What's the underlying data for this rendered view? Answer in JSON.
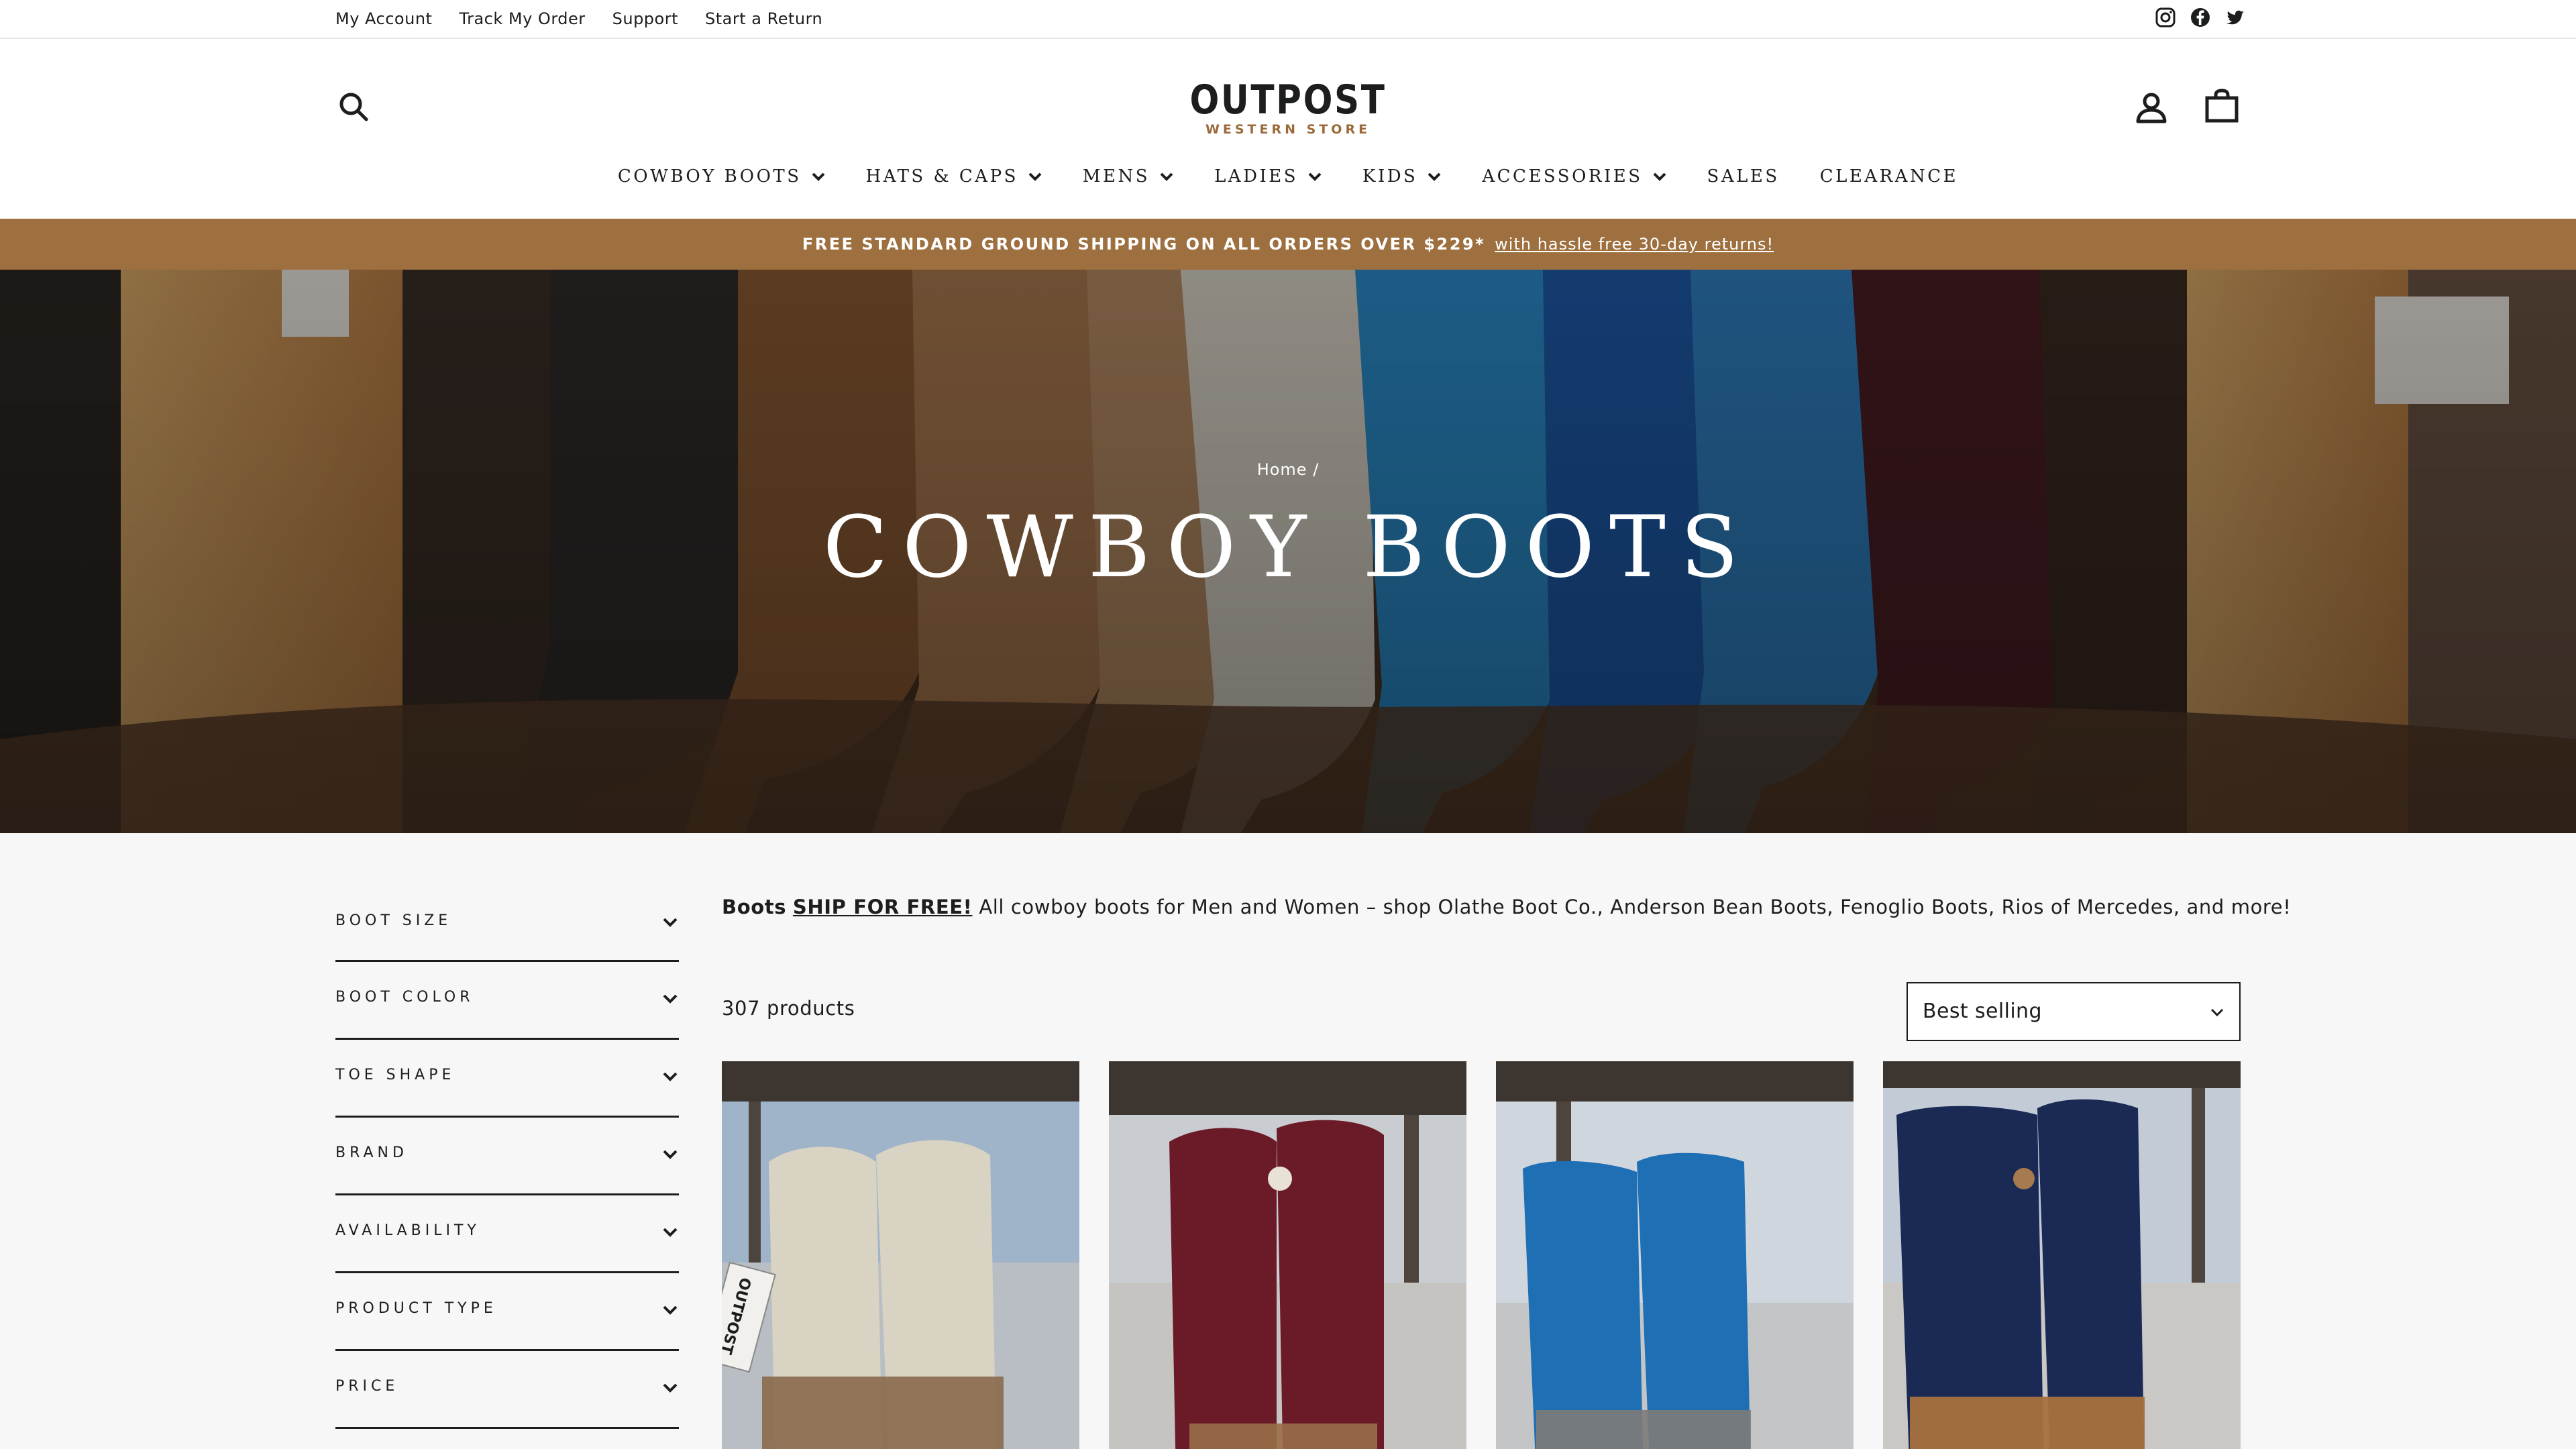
{
  "utility": {
    "links": [
      "My Account",
      "Track My Order",
      "Support",
      "Start a Return"
    ],
    "social": [
      "instagram-icon",
      "facebook-icon",
      "twitter-icon"
    ]
  },
  "header": {
    "logo_main": "OUTPOST",
    "logo_sub": "WESTERN STORE",
    "icons": [
      "search-icon",
      "account-icon",
      "cart-icon"
    ]
  },
  "nav": {
    "items": [
      {
        "label": "COWBOY BOOTS",
        "dropdown": true
      },
      {
        "label": "HATS & CAPS",
        "dropdown": true
      },
      {
        "label": "MENS",
        "dropdown": true
      },
      {
        "label": "LADIES",
        "dropdown": true
      },
      {
        "label": "KIDS",
        "dropdown": true
      },
      {
        "label": "ACCESSORIES",
        "dropdown": true
      },
      {
        "label": "SALES",
        "dropdown": false
      },
      {
        "label": "CLEARANCE",
        "dropdown": false
      }
    ]
  },
  "announcement": {
    "text": "FREE STANDARD GROUND SHIPPING ON ALL ORDERS OVER $229*",
    "link": "with hassle free 30-day returns!",
    "bg_color": "#9e6f3f"
  },
  "hero": {
    "breadcrumb_home": "Home",
    "breadcrumb_sep": "/",
    "title": "COWBOY BOOTS"
  },
  "filters": {
    "items": [
      "BOOT SIZE",
      "BOOT COLOR",
      "TOE SHAPE",
      "BRAND",
      "AVAILABILITY",
      "PRODUCT TYPE",
      "PRICE"
    ]
  },
  "collection": {
    "desc_lead": "Boots",
    "desc_link": "SHIP FOR FREE!",
    "desc_rest": "All cowboy boots for Men and Women – shop Olathe Boot Co., Anderson Bean Boots, Fenoglio Boots, Rios of Mercedes, and more!",
    "count": "307 products",
    "sort_value": "Best selling"
  },
  "products": [
    {
      "name": "bone-and-tan-boots",
      "shaft_color": "#d9d3c3",
      "foot_color": "#8a6a4c",
      "tag": "OUTPOST"
    },
    {
      "name": "burgundy-tall-boots",
      "shaft_color": "#6b1a28",
      "foot_color": "#9a6f48"
    },
    {
      "name": "turquoise-boots",
      "shaft_color": "#1f6fb5",
      "foot_color": "#7d7b78"
    },
    {
      "name": "navy-tall-boots",
      "shaft_color": "#1a2a55",
      "foot_color": "#a8713f"
    }
  ]
}
